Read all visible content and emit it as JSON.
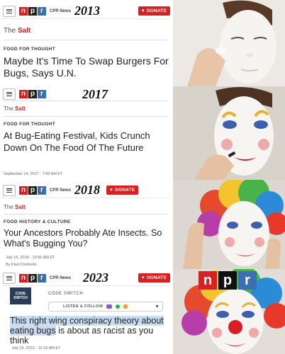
{
  "panels": [
    {
      "year": "2013",
      "cpr": "CPR News",
      "donate": "DONATE",
      "section_prefix": "The",
      "section": "Salt",
      "kicker": "FOOD FOR THOUGHT",
      "headline": "Maybe It's Time To Swap Burgers For Bugs, Says U.N."
    },
    {
      "year": "2017",
      "section_prefix": "The",
      "section": "Salt",
      "kicker": "FOOD FOR THOUGHT",
      "headline": "At Bug-Eating Festival, Kids Crunch Down On The Food Of The Future",
      "date": "September 14, 2017 · 7:00 AM ET"
    },
    {
      "year": "2018",
      "cpr": "CPR News",
      "donate": "DONATE",
      "section_prefix": "The",
      "section": "Salt",
      "kicker": "FOOD HISTORY & CULTURE",
      "headline": "Your Ancestors Probably Ate Insects. So What's Bugging You?",
      "date": "July 16, 2018 · 10:56 AM ET",
      "byline": "By Paul Chisholm"
    },
    {
      "year": "2023",
      "cpr": "CPR News",
      "donate": "DONATE",
      "thumb": "CODE SWITCH",
      "show": "CODE SWITCH",
      "listen": "LISTEN & FOLLOW",
      "quote_highlighted_1": "This right wing conspiracy theory about eating bugs",
      "quote_rest": " is about as racist as you think",
      "date": "July 19, 2023 · 12:15 AM ET"
    }
  ],
  "logo": {
    "n": "n",
    "p": "p",
    "r": "r"
  },
  "colors": {
    "npr_red": "#d62021",
    "npr_black": "#111111",
    "npr_blue": "#3a6fb0",
    "highlight": "#c9dcf2"
  }
}
